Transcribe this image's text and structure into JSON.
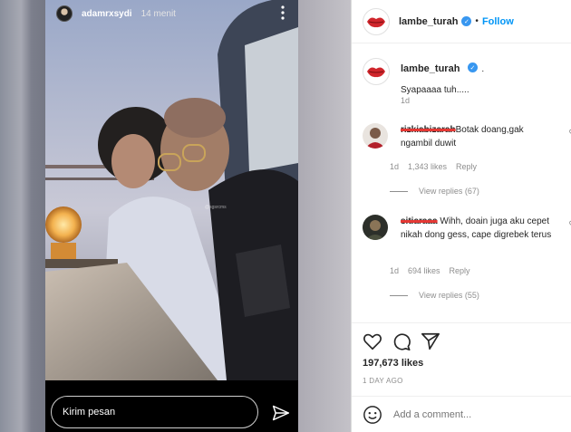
{
  "story": {
    "username": "adamrxsydi",
    "time": "14 menit",
    "reply_placeholder": "Kirim pesan",
    "watermark": "@sgsrcms",
    "icons": {
      "more": "more-vertical-icon",
      "send": "paper-plane-icon"
    }
  },
  "post": {
    "header": {
      "username": "lambe_turah",
      "follow_label": "Follow",
      "separator": "•"
    },
    "caption": {
      "username": "lambe_turah",
      "separator": ".",
      "text": "Syapaaaa tuh.....",
      "time": "1d"
    },
    "comments": [
      {
        "username": "rizkiabizarah",
        "text": "Botak doang,gak ngambil duwit",
        "time": "1d",
        "likes": "1,343 likes",
        "reply_label": "Reply",
        "view_replies": "View replies (67)"
      },
      {
        "username": "sitiaraaa",
        "text": "Wihh, doain juga aku cepet nikah dong gess, cape digrebek terus",
        "time": "1d",
        "likes": "694 likes",
        "reply_label": "Reply",
        "view_replies": "View replies (55)"
      }
    ],
    "likes_count": "197,673 likes",
    "timestamp": "1 DAY AGO",
    "add_comment_placeholder": "Add a comment...",
    "icons": {
      "like": "heart-icon",
      "comment": "comment-icon",
      "share": "share-icon",
      "emoji": "emoji-icon"
    }
  },
  "colors": {
    "accent": "#0095f6",
    "verified": "#3897f0",
    "strike": "#e53935",
    "text": "#262626",
    "muted": "#8e8e8e"
  }
}
